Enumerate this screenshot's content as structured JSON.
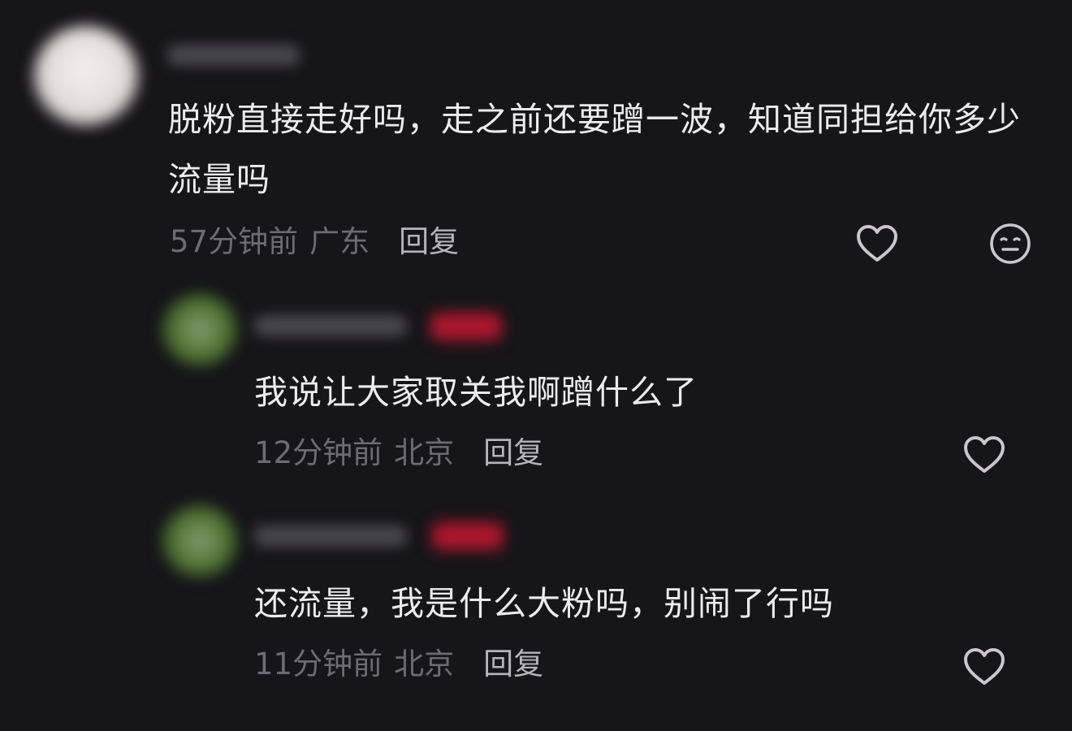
{
  "colors": {
    "background": "#161519",
    "text_primary": "#ecebef",
    "text_meta": "#6d6b73",
    "reply_link": "#b6b4bb",
    "icon": "#c9c7cd",
    "badge_blur": "#b0162e"
  },
  "comments": [
    {
      "text": "脱粉直接走好吗，走之前还要蹭一波，知道同担给你多少流量吗",
      "time": "57分钟前",
      "location": "广东",
      "reply_label": "回复",
      "icons": [
        "heart-outline-icon",
        "emoji-face-icon"
      ],
      "replies": [
        {
          "text": "我说让大家取关我啊蹭什么了",
          "time": "12分钟前",
          "location": "北京",
          "reply_label": "回复",
          "icons": [
            "heart-outline-icon"
          ]
        },
        {
          "text": "还流量，我是什么大粉吗，别闹了行吗",
          "time": "11分钟前",
          "location": "北京",
          "reply_label": "回复",
          "icons": [
            "heart-outline-icon"
          ]
        }
      ]
    }
  ]
}
